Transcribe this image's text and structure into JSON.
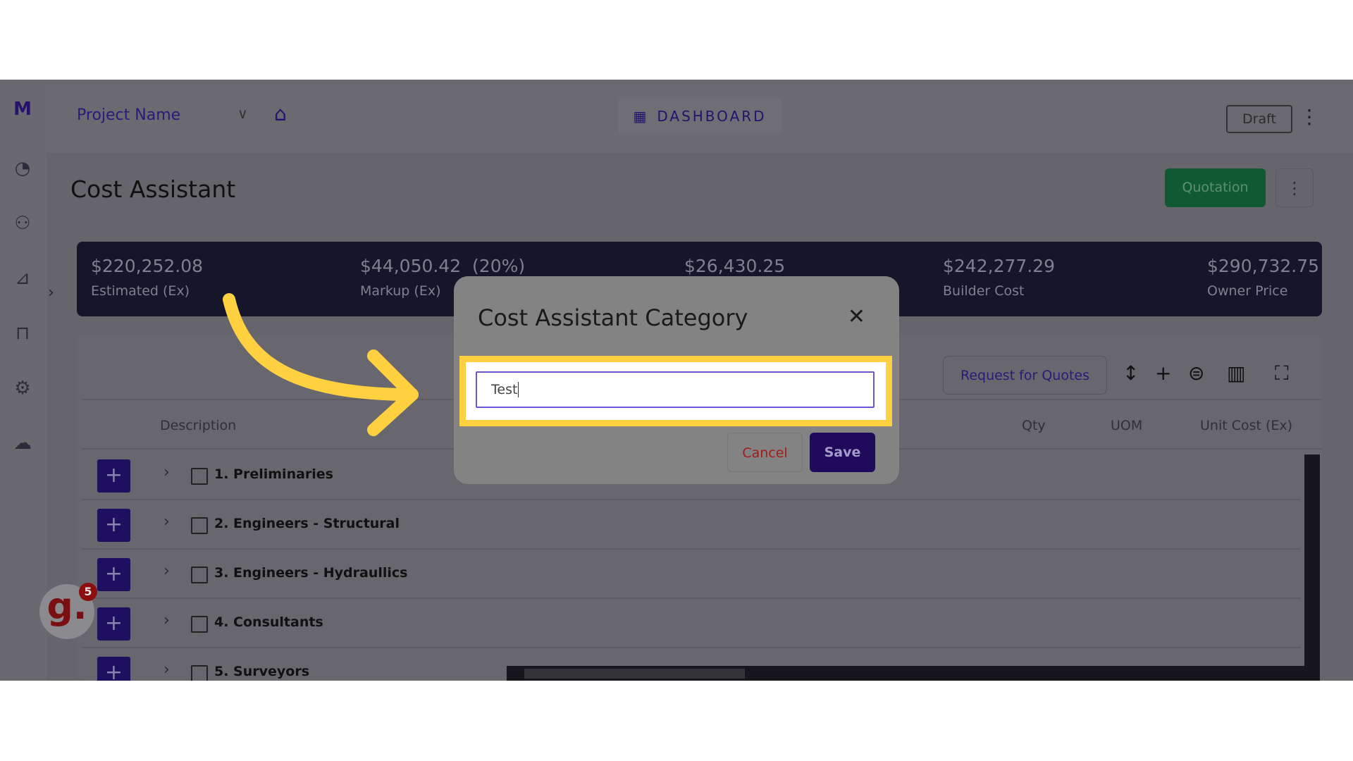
{
  "header": {
    "project": "Project Name",
    "dashboard": "DASHBOARD",
    "draft": "Draft"
  },
  "page": {
    "title": "Cost Assistant",
    "quotation": "Quotation"
  },
  "stats": [
    {
      "value": "$220,252.08",
      "label": "Estimated (Ex)"
    },
    {
      "value": "$44,050.42  (20%)",
      "label": "Markup (Ex)"
    },
    {
      "value": "$26,430.25",
      "label": ""
    },
    {
      "value": "$242,277.29",
      "label": "Builder Cost"
    },
    {
      "value": "$290,732.75",
      "label": "Owner Price"
    }
  ],
  "toolbar": {
    "rfq": "Request for Quotes"
  },
  "table": {
    "columns": [
      "Description",
      "Qty",
      "UOM",
      "Unit Cost (Ex)"
    ],
    "rows": [
      "1. Preliminaries",
      "2. Engineers - Structural",
      "3. Engineers - Hydraullics",
      "4. Consultants",
      "5. Surveyors"
    ]
  },
  "badge": {
    "letter": "g.",
    "count": "5"
  },
  "modal": {
    "title": "Cost Assistant Category",
    "input_value": "Test",
    "cancel": "Cancel",
    "save": "Save"
  },
  "colors": {
    "accent": "#24126e",
    "highlight": "#ffd040",
    "quotation": "#0f5a32"
  }
}
